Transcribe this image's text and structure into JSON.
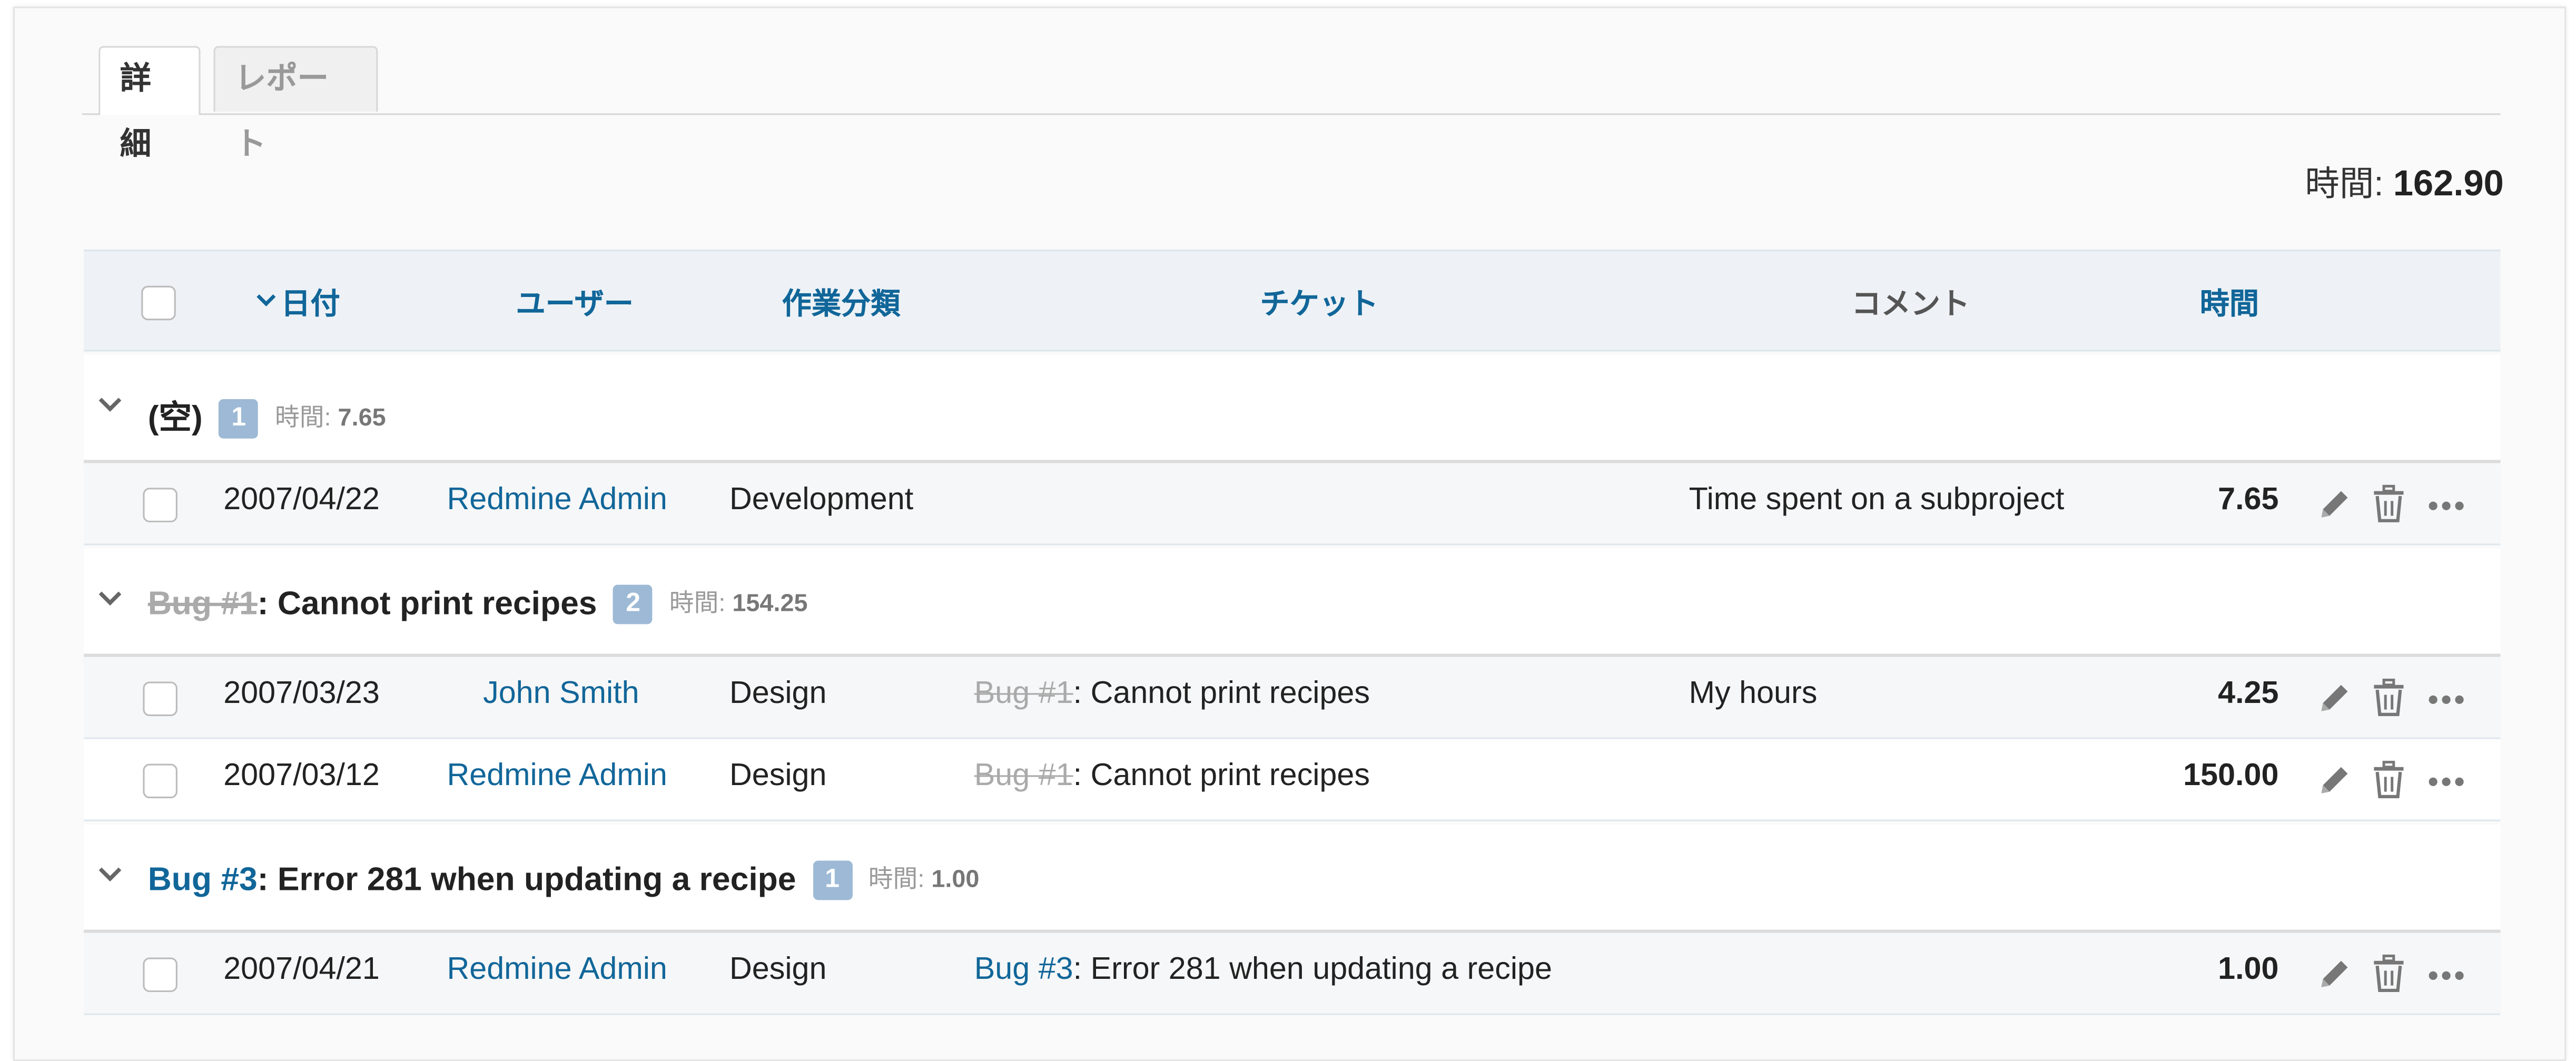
{
  "tabs": [
    {
      "label": "詳細",
      "selected": true
    },
    {
      "label": "レポート",
      "selected": false
    }
  ],
  "total": {
    "label": "時間:",
    "value": "162.90"
  },
  "columns": {
    "date": "日付",
    "user": "ユーザー",
    "activity": "作業分類",
    "issue": "チケット",
    "comment": "コメント",
    "hours": "時間"
  },
  "groups": [
    {
      "title_prefix": "",
      "title_main": "(空)",
      "count": "1",
      "total_label": "時間:",
      "total_value": "7.65",
      "rows": [
        {
          "date": "2007/04/22",
          "user": "Redmine Admin",
          "activity": "Development",
          "issue_ref": "",
          "issue_title": "",
          "comment": "Time spent on a subproject",
          "hours": "7.65"
        }
      ]
    },
    {
      "title_prefix": "Bug #1",
      "title_main": ": Cannot print recipes",
      "count": "2",
      "total_label": "時間:",
      "total_value": "154.25",
      "rows": [
        {
          "date": "2007/03/23",
          "user": "John Smith",
          "activity": "Design",
          "issue_ref": "Bug #1",
          "issue_title": ": Cannot print recipes",
          "comment": "My hours",
          "hours": "4.25"
        },
        {
          "date": "2007/03/12",
          "user": "Redmine Admin",
          "activity": "Design",
          "issue_ref": "Bug #1",
          "issue_title": ": Cannot print recipes",
          "comment": "",
          "hours": "150.00"
        }
      ]
    },
    {
      "title_prefix": "Bug #3",
      "title_main": ": Error 281 when updating a recipe",
      "count": "1",
      "total_label": "時間:",
      "total_value": "1.00",
      "rows": [
        {
          "date": "2007/04/21",
          "user": "Redmine Admin",
          "activity": "Design",
          "issue_ref": "Bug #3",
          "issue_title": ": Error 281 when updating a recipe",
          "comment": "",
          "hours": "1.00"
        }
      ]
    }
  ],
  "icons": {
    "edit": "pencil-icon",
    "delete": "trash-icon",
    "more": "more-icon",
    "toggle": "chevron-down-icon",
    "sort": "sort-desc-icon"
  },
  "colors": {
    "link": "#116699",
    "header_bg": "#eef2f6",
    "count_badge": "#9db9d5",
    "closed": "#aaaaaa"
  }
}
